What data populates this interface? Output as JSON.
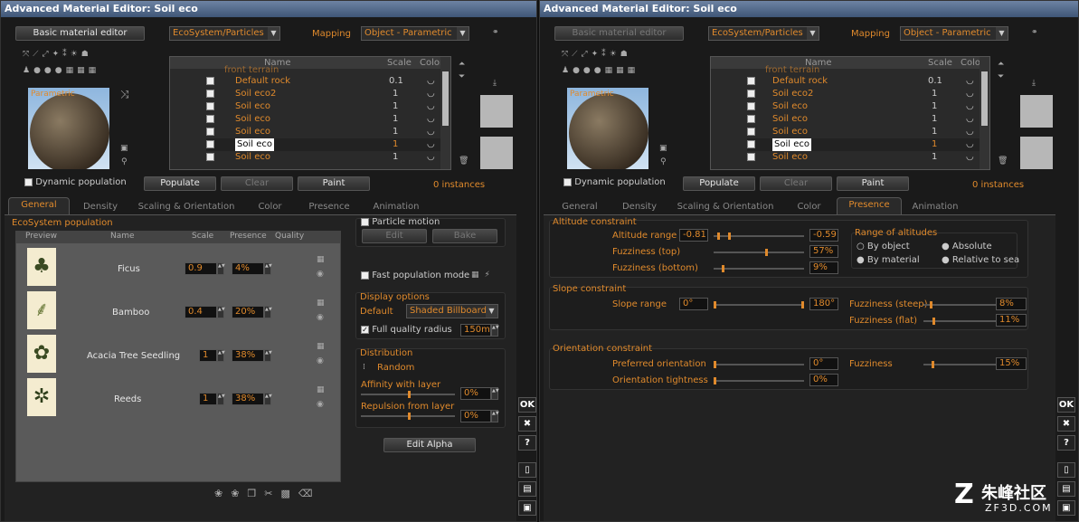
{
  "title": "Advanced Material Editor: Soil eco",
  "basic_editor": "Basic material editor",
  "category": "EcoSystem/Particles",
  "mapping_label": "Mapping",
  "mapping_value": "Object - Parametric",
  "preview_label": "Parametric",
  "dynamic_population": "Dynamic population",
  "eco_list": {
    "headers": [
      "Name",
      "Scale",
      "Color"
    ],
    "top_partial": "front terrain",
    "rows": [
      {
        "name": "Default rock",
        "scale": "0.1"
      },
      {
        "name": "Soil eco2",
        "scale": "1"
      },
      {
        "name": "Soil eco",
        "scale": "1"
      },
      {
        "name": "Soil eco",
        "scale": "1"
      },
      {
        "name": "Soil eco",
        "scale": "1"
      },
      {
        "name": "Soil eco",
        "scale": "1"
      },
      {
        "name": "Soil eco",
        "scale": "1"
      }
    ]
  },
  "buttons": {
    "populate": "Populate",
    "clear": "Clear",
    "paint": "Paint",
    "instances": "0 instances"
  },
  "tabs": [
    "General",
    "Density",
    "Scaling & Orientation",
    "Color",
    "Presence",
    "Animation"
  ],
  "general": {
    "section": "EcoSystem population",
    "headers": [
      "Preview",
      "Name",
      "Scale",
      "Presence",
      "Quality"
    ],
    "rows": [
      {
        "name": "Ficus",
        "scale": "0.9",
        "presence": "4%"
      },
      {
        "name": "Bamboo",
        "scale": "0.4",
        "presence": "20%"
      },
      {
        "name": "Acacia Tree Seedling",
        "scale": "1",
        "presence": "38%"
      },
      {
        "name": "Reeds",
        "scale": "1",
        "presence": "38%"
      }
    ],
    "particle_motion": "Particle motion",
    "edit": "Edit",
    "bake": "Bake",
    "fast_population": "Fast population mode",
    "display_options": "Display options",
    "display_mode_label": "Default",
    "display_mode": "Shaded Billboard",
    "full_quality_radius": "Full quality radius",
    "radius_value": "150m",
    "distribution": "Distribution",
    "distribution_mode": "Random",
    "affinity": "Affinity with layer",
    "affinity_value": "0%",
    "repulsion": "Repulsion from layer",
    "repulsion_value": "0%",
    "edit_alpha": "Edit Alpha"
  },
  "presence": {
    "altitude_section": "Altitude constraint",
    "altitude_range": "Altitude range",
    "alt_min": "-0.81",
    "alt_max": "-0.59",
    "fuzz_top": "Fuzziness (top)",
    "fuzz_top_val": "57%",
    "fuzz_bottom": "Fuzziness (bottom)",
    "fuzz_bottom_val": "9%",
    "range_title": "Range of altitudes",
    "by_object": "By object",
    "absolute": "Absolute",
    "by_material": "By material",
    "relative_to_sea": "Relative to sea",
    "slope_section": "Slope constraint",
    "slope_range": "Slope range",
    "slope_min": "0°",
    "slope_max": "180°",
    "fuzz_steep": "Fuzziness (steep)",
    "fuzz_steep_val": "8%",
    "fuzz_flat": "Fuzziness (flat)",
    "fuzz_flat_val": "11%",
    "orient_section": "Orientation constraint",
    "preferred": "Preferred orientation",
    "preferred_val": "0°",
    "tightness": "Orientation tightness",
    "tightness_val": "0%",
    "fuzziness": "Fuzziness",
    "fuzziness_val": "15%"
  },
  "side": {
    "ok": "OK",
    "cancel": "✖",
    "help": "?"
  },
  "watermark": "朱峰社区",
  "watermark_sub": "ZF3D.COM"
}
